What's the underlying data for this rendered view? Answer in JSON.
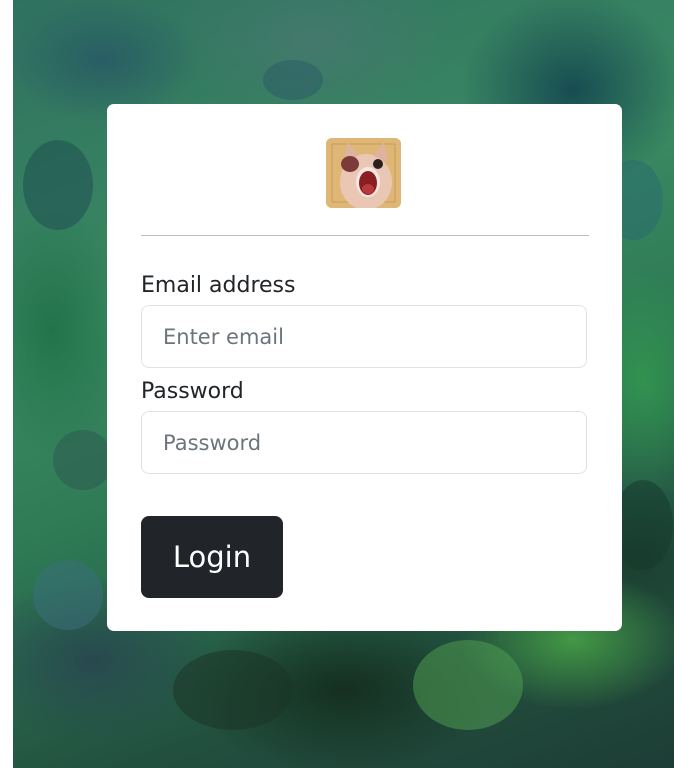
{
  "logo": {
    "icon": "screaming-cat-avatar-icon"
  },
  "form": {
    "email_label": "Email address",
    "email_placeholder": "Enter email",
    "email_value": "",
    "password_label": "Password",
    "password_placeholder": "Password",
    "password_value": "",
    "submit_label": "Login"
  },
  "colors": {
    "button_bg": "#212529",
    "card_bg": "#ffffff",
    "input_border": "#dee2e6",
    "divider": "#bfbfbf"
  }
}
